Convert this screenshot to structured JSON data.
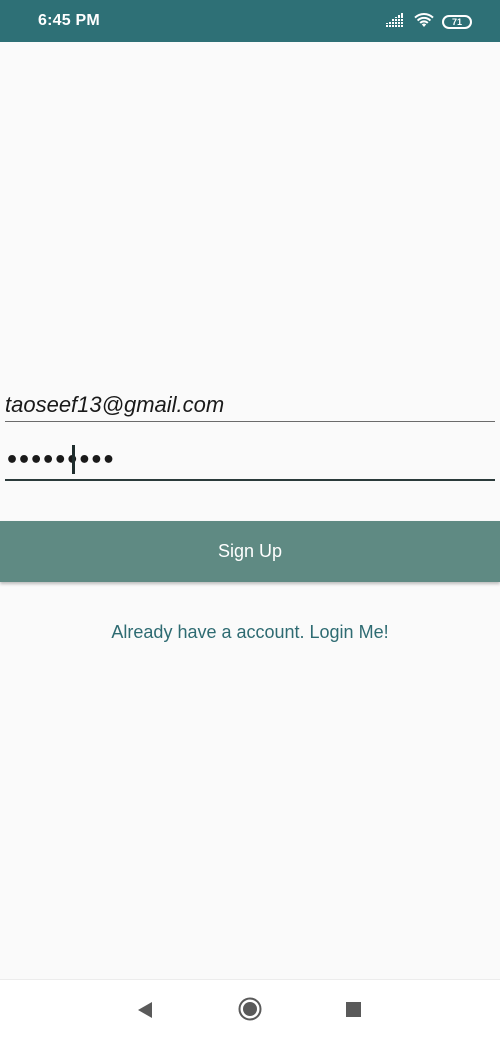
{
  "status_bar": {
    "time": "6:45 PM",
    "battery_level": "71",
    "background_color": "#2e7076",
    "icons": [
      "signal-icon",
      "wifi-icon",
      "battery-icon"
    ]
  },
  "form": {
    "email_value": "taoseef13@gmail.com",
    "password_masked": "•••••••••",
    "signup_label": "Sign Up",
    "login_link_label": "Already have a account. Login Me!"
  },
  "colors": {
    "button": "#5f8a83",
    "link": "#2e6b72",
    "background": "#fafafa"
  },
  "nav_bar": {
    "icons": [
      "back-icon",
      "home-icon",
      "recents-icon"
    ]
  }
}
